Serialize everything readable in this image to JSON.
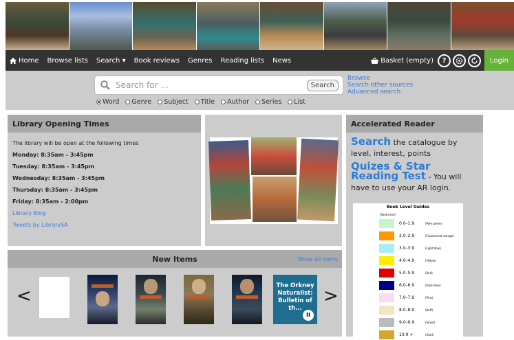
{
  "banner": {
    "photo_count": 8
  },
  "nav": {
    "items": [
      {
        "label": "Home",
        "name": "nav-home"
      },
      {
        "label": "Browse lists",
        "name": "nav-browse-lists"
      },
      {
        "label": "Search ▾",
        "name": "nav-search"
      },
      {
        "label": "Book reviews",
        "name": "nav-book-reviews"
      },
      {
        "label": "Genres",
        "name": "nav-genres"
      },
      {
        "label": "Reading lists",
        "name": "nav-reading-lists"
      },
      {
        "label": "News",
        "name": "nav-news"
      }
    ],
    "basket": "Basket (empty)",
    "help": "?",
    "login": "Login"
  },
  "search": {
    "placeholder": "Search for ...",
    "button": "Search",
    "radios": [
      {
        "label": "Word",
        "selected": true
      },
      {
        "label": "Genre",
        "selected": false
      },
      {
        "label": "Subject",
        "selected": false
      },
      {
        "label": "Title",
        "selected": false
      },
      {
        "label": "Author",
        "selected": false
      },
      {
        "label": "Series",
        "selected": false
      },
      {
        "label": "List",
        "selected": false
      }
    ],
    "links": [
      "Browse",
      "Search other sources",
      "Advanced search"
    ]
  },
  "hours": {
    "title": "Library Opening Times",
    "intro": "The library will be open at the following times",
    "days": [
      "Monday: 8:35am - 3:45pm",
      "Tuesday: 8:35am - 3:45pm",
      "Wednesday: 8:35am - 3:45pm",
      "Thursday: 8:35am - 3:45pm",
      "Friday: 8:35am - 2:00pm"
    ],
    "links": [
      "Library Blog",
      "Tweets by LibrarySA"
    ]
  },
  "ar": {
    "title": "Accelerated Reader",
    "search_big": "Search",
    "search_rest": " the catalogue by level, interest, points",
    "quiz_big": "Quizes & Star Reading Test",
    "quiz_rest": " - You will have to use your AR login.",
    "guide_title": "Book Level Guides",
    "guide_header": "Book Level",
    "levels": [
      {
        "range": "0.0–1.9",
        "name": "(Pale green)",
        "color": "#c8f5c8"
      },
      {
        "range": "2.0–2.9",
        "name": "(Fluorescent orange)",
        "color": "#ff9900"
      },
      {
        "range": "3.0–3.9",
        "name": "(Light blue)",
        "color": "#a8eef8"
      },
      {
        "range": "4.0–4.9",
        "name": "(Yellow)",
        "color": "#ffee00"
      },
      {
        "range": "5.0–5.9",
        "name": "(Red)",
        "color": "#e00000"
      },
      {
        "range": "6.0–6.9",
        "name": "(Dark blue)",
        "color": "#000088"
      },
      {
        "range": "7.0–7.9",
        "name": "(Pink)",
        "color": "#f8dcf0"
      },
      {
        "range": "8.0–8.9",
        "name": "(Buff)",
        "color": "#f1e6c0"
      },
      {
        "range": "9.0–9.9",
        "name": "(Silver)",
        "color": "#bbbbbb"
      },
      {
        "range": "10.0 +",
        "name": "(Gold)",
        "color": "#d4a530"
      }
    ]
  },
  "new_items": {
    "title": "New Items",
    "show_all": "Show all items",
    "prev": "<",
    "next": ">",
    "orkney": "The Orkney Naturalist: Bulletin of th...",
    "pause": "II"
  }
}
